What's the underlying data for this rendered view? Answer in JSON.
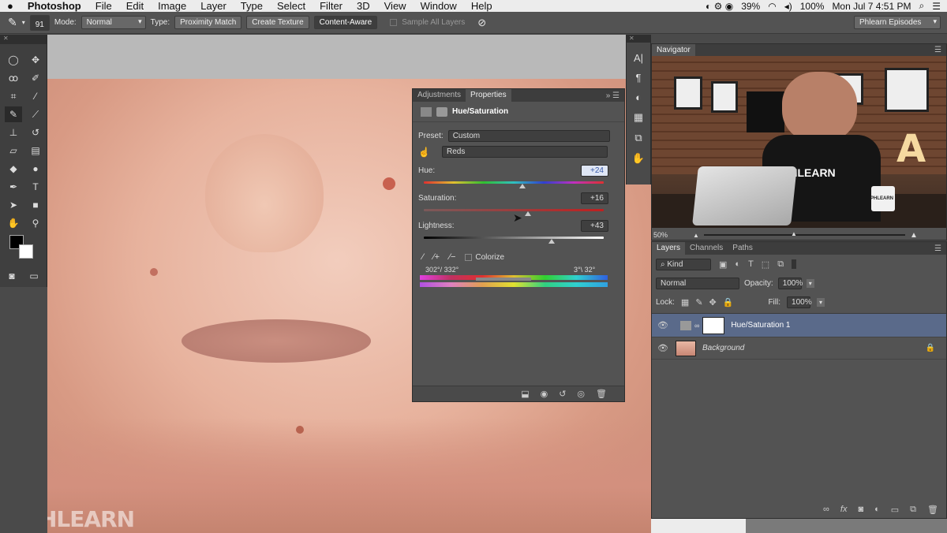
{
  "menubar": {
    "apple": "",
    "items": [
      "Photoshop",
      "File",
      "Edit",
      "Image",
      "Layer",
      "Type",
      "Select",
      "Filter",
      "3D",
      "View",
      "Window",
      "Help"
    ],
    "battery": "39%",
    "battery2": "100%",
    "clock": "Mon Jul 7  4:51 PM"
  },
  "options": {
    "brush_size": "91",
    "mode_label": "Mode:",
    "mode_value": "Normal",
    "type_label": "Type:",
    "type_buttons": [
      "Proximity Match",
      "Create Texture",
      "Content-Aware"
    ],
    "sample_all": "Sample All Layers",
    "workspace": "Phlearn Episodes"
  },
  "properties": {
    "tabs": [
      "Adjustments",
      "Properties"
    ],
    "title": "Hue/Saturation",
    "preset_label": "Preset:",
    "preset_value": "Custom",
    "channel_value": "Reds",
    "hue_label": "Hue:",
    "hue_value": "+24",
    "hue_pos": 0.55,
    "sat_label": "Saturation:",
    "sat_value": "+16",
    "sat_pos": 0.58,
    "light_label": "Lightness:",
    "light_value": "+43",
    "light_pos": 0.71,
    "colorize": "Colorize",
    "range_left": "302°/ 332°",
    "range_right": "3°\\ 32°"
  },
  "navigator": {
    "title": "Navigator",
    "zoom": "50%",
    "shirt_text": "PHLEARN",
    "mug_text": "PHLEARN"
  },
  "layers": {
    "tabs": [
      "Layers",
      "Channels",
      "Paths"
    ],
    "kind": "Kind",
    "blend": "Normal",
    "opacity_label": "Opacity:",
    "opacity_value": "100%",
    "lock_label": "Lock:",
    "fill_label": "Fill:",
    "fill_value": "100%",
    "rows": [
      "Hue/Saturation 1",
      "Background"
    ]
  },
  "watermark": "PHLEARN",
  "colors": {
    "accent": "#5a6a8a",
    "panel": "#535353",
    "dark": "#3d3d3d"
  }
}
